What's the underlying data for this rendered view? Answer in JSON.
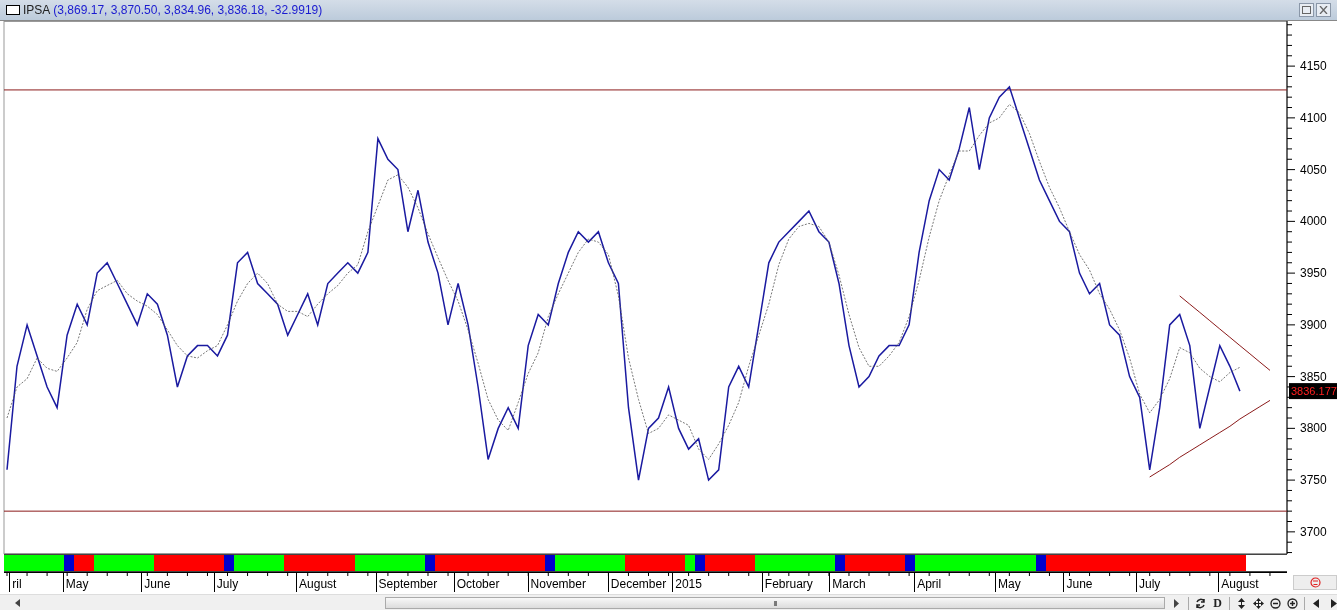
{
  "window": {
    "symbol": "IPSA",
    "quote": "(3,869.17, 3,870.50, 3,834.96, 3,836.18, -32.9919)"
  },
  "chart": {
    "last_price_label": "3836.177",
    "chart_data": {
      "type": "line",
      "ylim": [
        3678.6,
        4193.6
      ],
      "categories": [
        null,
        "ril",
        null,
        null,
        null,
        null,
        null,
        "May",
        null,
        null,
        null,
        null,
        null,
        null,
        null,
        "June",
        null,
        null,
        null,
        null,
        null,
        null,
        "July",
        null,
        null,
        null,
        null,
        null,
        null,
        null,
        null,
        "August",
        null,
        null,
        null,
        null,
        null,
        null,
        null,
        null,
        "September",
        null,
        null,
        null,
        null,
        null,
        null,
        "October",
        null,
        null,
        null,
        null,
        null,
        null,
        null,
        "November",
        null,
        null,
        null,
        null,
        null,
        null,
        null,
        "December",
        null,
        null,
        null,
        null,
        "2015",
        null,
        null,
        null,
        null,
        null,
        null,
        null,
        null,
        null,
        "February",
        null,
        null,
        null,
        null,
        null,
        "March",
        null,
        null,
        null,
        null,
        null,
        null,
        null,
        "April",
        null,
        null,
        null,
        null,
        null,
        null,
        null,
        "May",
        null,
        null,
        null,
        null,
        null,
        null,
        "June",
        null,
        null,
        null,
        null,
        null,
        null,
        "July",
        null,
        null,
        null,
        null,
        null,
        null,
        null,
        null,
        "August",
        null,
        null,
        null,
        null
      ],
      "yticks": [
        3700,
        3750,
        3800,
        3850,
        3900,
        3950,
        4000,
        4050,
        4100,
        4150
      ],
      "series": [
        {
          "color": "#1a1aa0",
          "values": [
            3760,
            3860,
            3900,
            3870,
            3840,
            3820,
            3890,
            3920,
            3900,
            3950,
            3960,
            3940,
            3920,
            3900,
            3930,
            3920,
            3890,
            3840,
            3870,
            3880,
            3880,
            3870,
            3890,
            3960,
            3970,
            3940,
            3930,
            3920,
            3890,
            3910,
            3930,
            3900,
            3940,
            3950,
            3960,
            3950,
            3970,
            4080,
            4060,
            4050,
            3990,
            4030,
            3980,
            3950,
            3900,
            3940,
            3900,
            3840,
            3770,
            3800,
            3820,
            3800,
            3880,
            3910,
            3900,
            3940,
            3970,
            3990,
            3980,
            3990,
            3960,
            3940,
            3820,
            3750,
            3800,
            3810,
            3840,
            3800,
            3780,
            3790,
            3750,
            3760,
            3840,
            3860,
            3840,
            3900,
            3960,
            3980,
            3990,
            4000,
            4010,
            3990,
            3980,
            3940,
            3880,
            3840,
            3850,
            3870,
            3880,
            3880,
            3900,
            3970,
            4020,
            4050,
            4040,
            4070,
            4110,
            4050,
            4100,
            4120,
            4130,
            4100,
            4070,
            4040,
            4020,
            4000,
            3990,
            3950,
            3930,
            3940,
            3900,
            3890,
            3850,
            3830,
            3760,
            3820,
            3900,
            3910,
            3880,
            3800,
            3840,
            3880,
            3860,
            3836,
            null,
            null,
            null,
            null
          ]
        },
        {
          "color": "#555555",
          "line_style": "dashed",
          "values": [
            3810,
            3840,
            3848,
            3868,
            3858,
            3855,
            3868,
            3883,
            3915,
            3933,
            3938,
            3943,
            3930,
            3923,
            3918,
            3910,
            3895,
            3880,
            3870,
            3868,
            3875,
            3880,
            3900,
            3923,
            3940,
            3950,
            3940,
            3920,
            3913,
            3913,
            3908,
            3920,
            3930,
            3938,
            3950,
            3958,
            3990,
            4015,
            4040,
            4045,
            4033,
            4013,
            3988,
            3965,
            3943,
            3923,
            3895,
            3863,
            3828,
            3808,
            3798,
            3825,
            3853,
            3873,
            3908,
            3930,
            3950,
            3970,
            3983,
            3980,
            3968,
            3928,
            3868,
            3828,
            3795,
            3800,
            3813,
            3808,
            3803,
            3780,
            3770,
            3785,
            3803,
            3825,
            3860,
            3890,
            3920,
            3958,
            3983,
            3995,
            3998,
            3995,
            3980,
            3948,
            3910,
            3878,
            3860,
            3860,
            3870,
            3883,
            3908,
            3943,
            3985,
            4020,
            4045,
            4068,
            4068,
            4083,
            4095,
            4100,
            4113,
            4105,
            4085,
            4058,
            4033,
            4013,
            3990,
            3968,
            3953,
            3930,
            3915,
            3895,
            3868,
            3833,
            3815,
            3828,
            3848,
            3878,
            3873,
            3858,
            3850,
            3845,
            3854,
            3859,
            null,
            null,
            null,
            null
          ]
        },
        {
          "color": "#8b1a1a",
          "values": [
            null,
            null,
            null,
            null,
            null,
            null,
            null,
            null,
            null,
            null,
            null,
            null,
            null,
            null,
            null,
            null,
            null,
            null,
            null,
            null,
            null,
            null,
            null,
            null,
            null,
            null,
            null,
            null,
            null,
            null,
            null,
            null,
            null,
            null,
            null,
            null,
            null,
            null,
            null,
            null,
            null,
            null,
            null,
            null,
            null,
            null,
            null,
            null,
            null,
            null,
            null,
            null,
            null,
            null,
            null,
            null,
            null,
            null,
            null,
            null,
            null,
            null,
            null,
            null,
            null,
            null,
            null,
            null,
            null,
            null,
            null,
            null,
            null,
            null,
            null,
            null,
            null,
            null,
            null,
            null,
            null,
            null,
            null,
            null,
            null,
            null,
            null,
            null,
            null,
            null,
            null,
            null,
            null,
            null,
            null,
            null,
            null,
            null,
            null,
            null,
            null,
            null,
            null,
            null,
            null,
            null,
            null,
            null,
            null,
            null,
            null,
            null,
            null,
            null,
            null,
            null,
            null,
            3928,
            3920,
            3912,
            3904,
            3896,
            3888,
            3880,
            3872,
            3864,
            3856,
            null
          ]
        },
        {
          "color": "#8b1a1a",
          "values": [
            null,
            null,
            null,
            null,
            null,
            null,
            null,
            null,
            null,
            null,
            null,
            null,
            null,
            null,
            null,
            null,
            null,
            null,
            null,
            null,
            null,
            null,
            null,
            null,
            null,
            null,
            null,
            null,
            null,
            null,
            null,
            null,
            null,
            null,
            null,
            null,
            null,
            null,
            null,
            null,
            null,
            null,
            null,
            null,
            null,
            null,
            null,
            null,
            null,
            null,
            null,
            null,
            null,
            null,
            null,
            null,
            null,
            null,
            null,
            null,
            null,
            null,
            null,
            null,
            null,
            null,
            null,
            null,
            null,
            null,
            null,
            null,
            null,
            null,
            null,
            null,
            null,
            null,
            null,
            null,
            null,
            null,
            null,
            null,
            null,
            null,
            null,
            null,
            null,
            null,
            null,
            null,
            null,
            null,
            null,
            null,
            null,
            null,
            null,
            null,
            null,
            null,
            null,
            null,
            null,
            null,
            null,
            null,
            null,
            null,
            null,
            null,
            null,
            null,
            3753,
            3759,
            3765,
            3772,
            3778,
            3784,
            3790,
            3796,
            3802,
            3809,
            3815,
            3821,
            3827,
            null
          ]
        }
      ],
      "ref_lines": [
        {
          "axis": "y",
          "value": 4127
        },
        {
          "axis": "y",
          "value": 3720
        }
      ]
    },
    "signal_strip": [
      {
        "color": "#00ff00"
      },
      {
        "color": "#00ff00"
      },
      {
        "color": "#00ff00"
      },
      {
        "color": "#00ff00"
      },
      {
        "color": "#00ff00"
      },
      {
        "color": "#00ff00"
      },
      {
        "color": "#0000cc"
      },
      {
        "color": "#ff0000"
      },
      {
        "color": "#ff0000"
      },
      {
        "color": "#00ff00"
      },
      {
        "color": "#00ff00"
      },
      {
        "color": "#00ff00"
      },
      {
        "color": "#00ff00"
      },
      {
        "color": "#00ff00"
      },
      {
        "color": "#00ff00"
      },
      {
        "color": "#ff0000"
      },
      {
        "color": "#ff0000"
      },
      {
        "color": "#ff0000"
      },
      {
        "color": "#ff0000"
      },
      {
        "color": "#ff0000"
      },
      {
        "color": "#ff0000"
      },
      {
        "color": "#ff0000"
      },
      {
        "color": "#0000cc"
      },
      {
        "color": "#00ff00"
      },
      {
        "color": "#00ff00"
      },
      {
        "color": "#00ff00"
      },
      {
        "color": "#00ff00"
      },
      {
        "color": "#00ff00"
      },
      {
        "color": "#ff0000"
      },
      {
        "color": "#ff0000"
      },
      {
        "color": "#ff0000"
      },
      {
        "color": "#ff0000"
      },
      {
        "color": "#ff0000"
      },
      {
        "color": "#ff0000"
      },
      {
        "color": "#ff0000"
      },
      {
        "color": "#00ff00"
      },
      {
        "color": "#00ff00"
      },
      {
        "color": "#00ff00"
      },
      {
        "color": "#00ff00"
      },
      {
        "color": "#00ff00"
      },
      {
        "color": "#00ff00"
      },
      {
        "color": "#00ff00"
      },
      {
        "color": "#0000cc"
      },
      {
        "color": "#ff0000"
      },
      {
        "color": "#ff0000"
      },
      {
        "color": "#ff0000"
      },
      {
        "color": "#ff0000"
      },
      {
        "color": "#ff0000"
      },
      {
        "color": "#ff0000"
      },
      {
        "color": "#ff0000"
      },
      {
        "color": "#ff0000"
      },
      {
        "color": "#ff0000"
      },
      {
        "color": "#ff0000"
      },
      {
        "color": "#ff0000"
      },
      {
        "color": "#0000cc"
      },
      {
        "color": "#00ff00"
      },
      {
        "color": "#00ff00"
      },
      {
        "color": "#00ff00"
      },
      {
        "color": "#00ff00"
      },
      {
        "color": "#00ff00"
      },
      {
        "color": "#00ff00"
      },
      {
        "color": "#00ff00"
      },
      {
        "color": "#ff0000"
      },
      {
        "color": "#ff0000"
      },
      {
        "color": "#ff0000"
      },
      {
        "color": "#ff0000"
      },
      {
        "color": "#ff0000"
      },
      {
        "color": "#ff0000"
      },
      {
        "color": "#00ff00"
      },
      {
        "color": "#0000cc"
      },
      {
        "color": "#ff0000"
      },
      {
        "color": "#ff0000"
      },
      {
        "color": "#ff0000"
      },
      {
        "color": "#ff0000"
      },
      {
        "color": "#ff0000"
      },
      {
        "color": "#00ff00"
      },
      {
        "color": "#00ff00"
      },
      {
        "color": "#00ff00"
      },
      {
        "color": "#00ff00"
      },
      {
        "color": "#00ff00"
      },
      {
        "color": "#00ff00"
      },
      {
        "color": "#00ff00"
      },
      {
        "color": "#00ff00"
      },
      {
        "color": "#0000cc"
      },
      {
        "color": "#ff0000"
      },
      {
        "color": "#ff0000"
      },
      {
        "color": "#ff0000"
      },
      {
        "color": "#ff0000"
      },
      {
        "color": "#ff0000"
      },
      {
        "color": "#ff0000"
      },
      {
        "color": "#0000cc"
      },
      {
        "color": "#00ff00"
      },
      {
        "color": "#00ff00"
      },
      {
        "color": "#00ff00"
      },
      {
        "color": "#00ff00"
      },
      {
        "color": "#00ff00"
      },
      {
        "color": "#00ff00"
      },
      {
        "color": "#00ff00"
      },
      {
        "color": "#00ff00"
      },
      {
        "color": "#00ff00"
      },
      {
        "color": "#00ff00"
      },
      {
        "color": "#00ff00"
      },
      {
        "color": "#00ff00"
      },
      {
        "color": "#0000cc"
      },
      {
        "color": "#ff0000"
      },
      {
        "color": "#ff0000"
      },
      {
        "color": "#ff0000"
      },
      {
        "color": "#ff0000"
      },
      {
        "color": "#ff0000"
      },
      {
        "color": "#ff0000"
      },
      {
        "color": "#ff0000"
      },
      {
        "color": "#ff0000"
      },
      {
        "color": "#ff0000"
      },
      {
        "color": "#ff0000"
      },
      {
        "color": "#ff0000"
      },
      {
        "color": "#ff0000"
      },
      {
        "color": "#ff0000"
      },
      {
        "color": "#ff0000"
      },
      {
        "color": "#ff0000"
      },
      {
        "color": "#ff0000"
      },
      {
        "color": "#ff0000"
      },
      {
        "color": "#ff0000"
      },
      {
        "color": "#ff0000"
      },
      {
        "color": "#ff0000"
      }
    ]
  },
  "toolbar": {
    "scroll_grip": "III",
    "daily_button": "D"
  }
}
